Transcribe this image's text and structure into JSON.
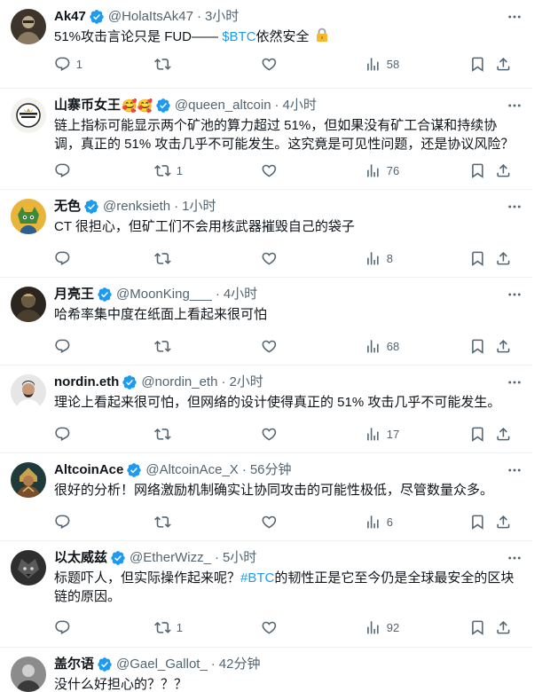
{
  "tweets": [
    {
      "name": "Ak47",
      "handle": "@HolaItsAk47",
      "time": "3小时",
      "text_pre": "51%攻击言论只是 FUD—— ",
      "text_link": "$BTC",
      "text_post": "依然安全",
      "replies": "1",
      "retweets": "",
      "likes": "",
      "views": "58"
    },
    {
      "name": "山寨币女王",
      "name_emoji": "🥰🥰",
      "handle": "@queen_altcoin",
      "time": "4小时",
      "text": "链上指标可能显示两个矿池的算力超过 51%，但如果没有矿工合谋和持续协调，真正的 51% 攻击几乎不可能发生。这究竟是可见性问题，还是协议风险？",
      "replies": "",
      "retweets": "1",
      "likes": "",
      "views": "76"
    },
    {
      "name": "无色",
      "handle": "@renksieth",
      "time": "1小时",
      "text": "CT 很担心，但矿工们不会用核武器摧毁自己的袋子",
      "replies": "",
      "retweets": "",
      "likes": "",
      "views": "8"
    },
    {
      "name": "月亮王",
      "handle": "@MoonKing___",
      "time": "4小时",
      "text": "哈希率集中度在纸面上看起来很可怕",
      "replies": "",
      "retweets": "",
      "likes": "",
      "views": "68"
    },
    {
      "name": "nordin.eth",
      "handle": "@nordin_eth",
      "time": "2小时",
      "text": "理论上看起来很可怕，但网络的设计使得真正的 51% 攻击几乎不可能发生。",
      "replies": "",
      "retweets": "",
      "likes": "",
      "views": "17"
    },
    {
      "name": "AltcoinAce",
      "handle": "@AltcoinAce_X",
      "time": "56分钟",
      "text": "很好的分析！网络激励机制确实让协同攻击的可能性极低，尽管数量众多。",
      "replies": "",
      "retweets": "",
      "likes": "",
      "views": "6"
    },
    {
      "name": "以太威兹",
      "handle": "@EtherWizz_",
      "time": "5小时",
      "text_pre": "标题吓人，但实际操作起来呢？",
      "text_link": "#BTC",
      "text_post": "的韧性正是它至今仍是全球最安全的区块链的原因。",
      "replies": "",
      "retweets": "1",
      "likes": "",
      "views": "92"
    },
    {
      "name": "盖尔语",
      "handle": "@Gael_Gallot_",
      "time": "42分钟",
      "text": "没什么好担心的？？？"
    }
  ],
  "separator": "·",
  "colors": {
    "verified_badge": "#1d9bf0",
    "link": "#1d9bf0",
    "secondary_text": "#536471",
    "divider": "#eff3f4"
  },
  "icons": [
    "reply-icon",
    "retweet-icon",
    "like-icon",
    "views-icon",
    "bookmark-icon",
    "share-icon",
    "more-icon",
    "verified-badge-icon",
    "lock-icon"
  ]
}
